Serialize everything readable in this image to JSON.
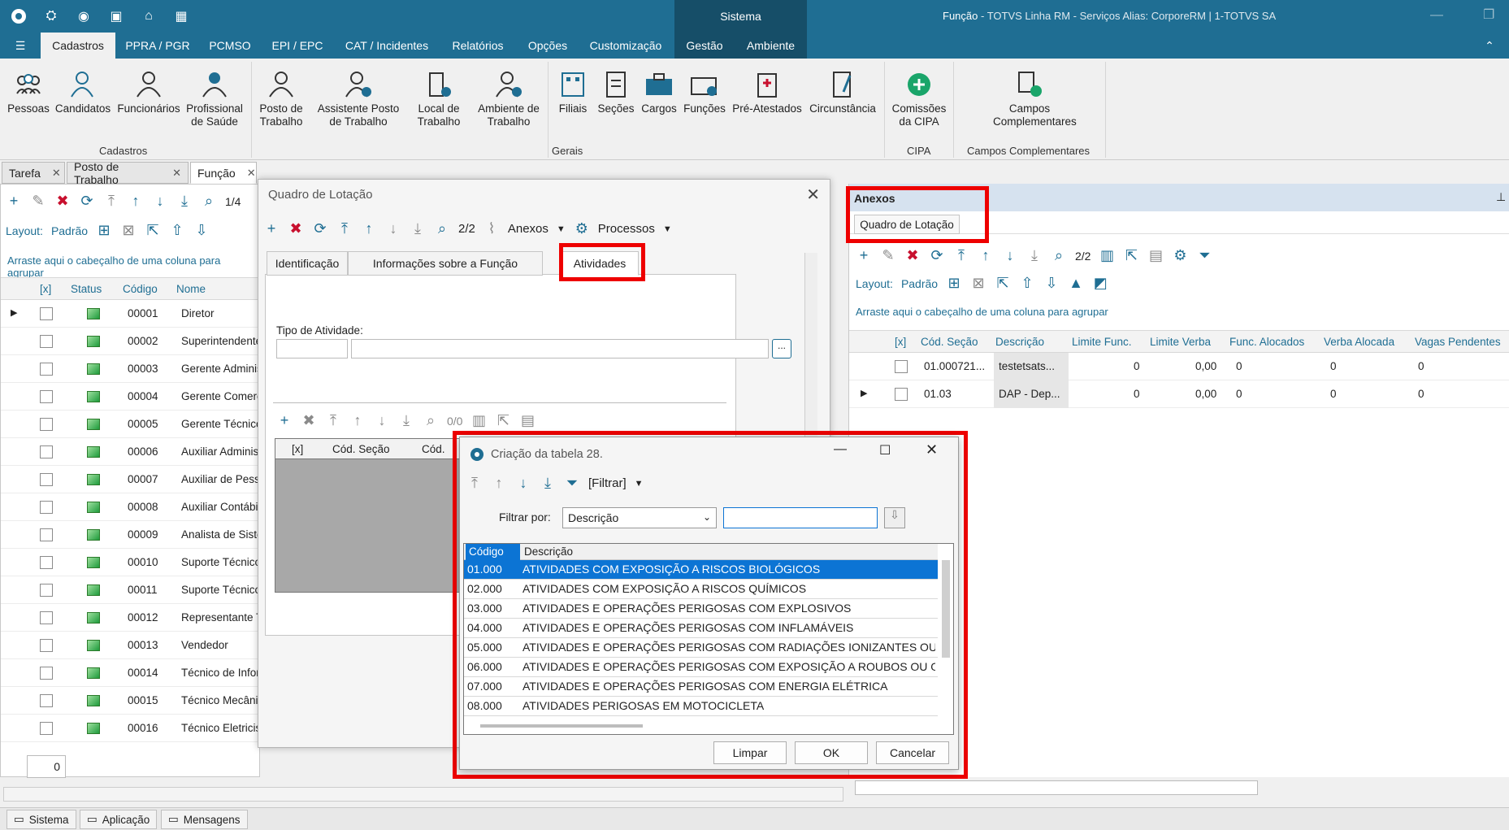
{
  "titlebar": {
    "system_tab": "Sistema",
    "app_prefix": "Função",
    "app_rest": " - TOTVS Linha RM - Serviços  Alias: CorporeRM | 1-TOTVS SA"
  },
  "ribbon_tabs": [
    "Cadastros",
    "PPRA / PGR",
    "PCMSO",
    "EPI / EPC",
    "CAT / Incidentes",
    "Relatórios",
    "Opções",
    "Customização",
    "Gestão",
    "Ambiente"
  ],
  "ribbon": {
    "cadastros": [
      "Pessoas",
      "Candidatos",
      "Funcionários",
      "Profissional de Saúde"
    ],
    "gerais": [
      "Posto de Trabalho",
      "Assistente Posto de Trabalho",
      "Local de Trabalho",
      "Ambiente de Trabalho",
      "Filiais",
      "Seções",
      "Cargos",
      "Funções",
      "Pré-Atestados",
      "Circunstância"
    ],
    "cipa": [
      "Comissões da CIPA"
    ],
    "campos": [
      "Campos Complementares"
    ],
    "group_labels": {
      "cadastros": "Cadastros",
      "gerais": "Gerais",
      "cipa": "CIPA",
      "campos": "Campos Complementares"
    }
  },
  "doc_tabs": [
    "Tarefa",
    "Posto de Trabalho",
    "Função"
  ],
  "left": {
    "pager": "1/4",
    "layout_label": "Layout:",
    "layout_value": "Padrão",
    "group_hint": "Arraste aqui o cabeçalho de uma coluna para agrupar",
    "columns": [
      "[x]",
      "Status",
      "Código",
      "Nome"
    ],
    "rows": [
      {
        "code": "00001",
        "name": "Diretor"
      },
      {
        "code": "00002",
        "name": "Superintendente"
      },
      {
        "code": "00003",
        "name": "Gerente Administ"
      },
      {
        "code": "00004",
        "name": "Gerente Comerc"
      },
      {
        "code": "00005",
        "name": "Gerente Técnico"
      },
      {
        "code": "00006",
        "name": "Auxiliar Administ"
      },
      {
        "code": "00007",
        "name": "Auxiliar de Pess"
      },
      {
        "code": "00008",
        "name": "Auxiliar Contábil"
      },
      {
        "code": "00009",
        "name": "Analista de Siste"
      },
      {
        "code": "00010",
        "name": "Suporte Técnico"
      },
      {
        "code": "00011",
        "name": "Suporte Técnico"
      },
      {
        "code": "00012",
        "name": "Representante T"
      },
      {
        "code": "00013",
        "name": "Vendedor"
      },
      {
        "code": "00014",
        "name": "Técnico de Infor"
      },
      {
        "code": "00015",
        "name": "Técnico Mecânic"
      },
      {
        "code": "00016",
        "name": "Técnico Eletricist"
      }
    ],
    "footer_count": "0"
  },
  "quadro": {
    "title": "Quadro de Lotação",
    "pager": "2/2",
    "anexos": "Anexos",
    "processos": "Processos",
    "tabs": [
      "Identificação",
      "Informações sobre a Função",
      "Atividades"
    ],
    "tipo_label": "Tipo de Atividade:",
    "inner_pager": "0/0",
    "inner_cols": [
      "[x]",
      "Cód. Seção",
      "Cód."
    ]
  },
  "anexos": {
    "title": "Anexos",
    "chip": "Quadro de Lotação",
    "pager": "2/2",
    "layout_label": "Layout:",
    "layout_value": "Padrão",
    "group_hint": "Arraste aqui o cabeçalho de uma coluna para agrupar",
    "columns": [
      "[x]",
      "Cód. Seção",
      "Descrição",
      "Limite Func.",
      "Limite Verba",
      "Func. Alocados",
      "Verba Alocada",
      "Vagas Pendentes"
    ],
    "rows": [
      {
        "sec": "01.000721...",
        "desc": "testetsats...",
        "lim": "0",
        "verba": "0,00",
        "func": "0",
        "valoc": "0",
        "vagas": "0"
      },
      {
        "sec": "01.03",
        "desc": "DAP - Dep...",
        "lim": "0",
        "verba": "0,00",
        "func": "0",
        "valoc": "0",
        "vagas": "0"
      }
    ]
  },
  "dialog": {
    "title": "Criação da tabela 28.",
    "filtrar": "[Filtrar]",
    "filter_label": "Filtrar por:",
    "filter_value": "Descrição",
    "filter_text": "",
    "col_code": "Código",
    "col_desc": "Descrição",
    "rows": [
      {
        "code": "01.000",
        "desc": "ATIVIDADES COM EXPOSIÇÃO A RISCOS BIOLÓGICOS"
      },
      {
        "code": "02.000",
        "desc": "ATIVIDADES COM EXPOSIÇÃO A RISCOS QUÍMICOS"
      },
      {
        "code": "03.000",
        "desc": "ATIVIDADES E OPERAÇÕES PERIGOSAS COM EXPLOSIVOS"
      },
      {
        "code": "04.000",
        "desc": "ATIVIDADES E OPERAÇÕES PERIGOSAS COM INFLAMÁVEIS"
      },
      {
        "code": "05.000",
        "desc": "ATIVIDADES E OPERAÇÕES PERIGOSAS COM RADIAÇÕES IONIZANTES OU SU"
      },
      {
        "code": "06.000",
        "desc": "ATIVIDADES E OPERAÇÕES PERIGOSAS COM EXPOSIÇÃO A ROUBOS OU OUT"
      },
      {
        "code": "07.000",
        "desc": "ATIVIDADES E OPERAÇÕES PERIGOSAS COM ENERGIA ELÉTRICA"
      },
      {
        "code": "08.000",
        "desc": "ATIVIDADES PERIGOSAS EM MOTOCICLETA"
      }
    ],
    "btn_limpar": "Limpar",
    "btn_ok": "OK",
    "btn_cancelar": "Cancelar"
  },
  "statusbar": [
    "Sistema",
    "Aplicação",
    "Mensagens"
  ],
  "colors": {
    "brand": "#1f6e93",
    "highlight": "#e00000",
    "selection": "#0c74d4"
  }
}
